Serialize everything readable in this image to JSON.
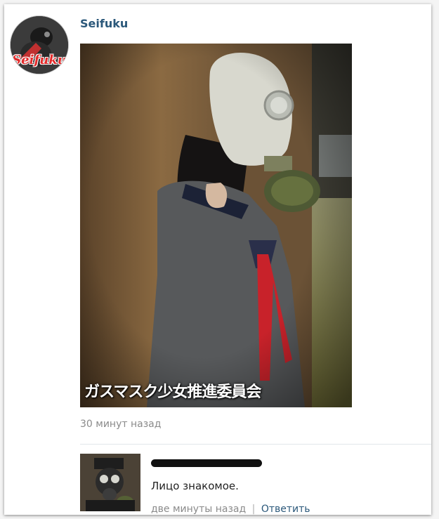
{
  "post": {
    "author_name": "Seifuku",
    "avatar_logo_text": "Seifuku",
    "photo_caption": "ガスマスク少女推進委員会",
    "timestamp": "30 минут назад"
  },
  "comment": {
    "text": "Лицо знакомое.",
    "time": "две минуты назад",
    "separator": "|",
    "reply_label": "Ответить"
  },
  "colors": {
    "link": "#2b587a",
    "meta": "#8a8a8a",
    "divider": "#e2e6ea"
  }
}
